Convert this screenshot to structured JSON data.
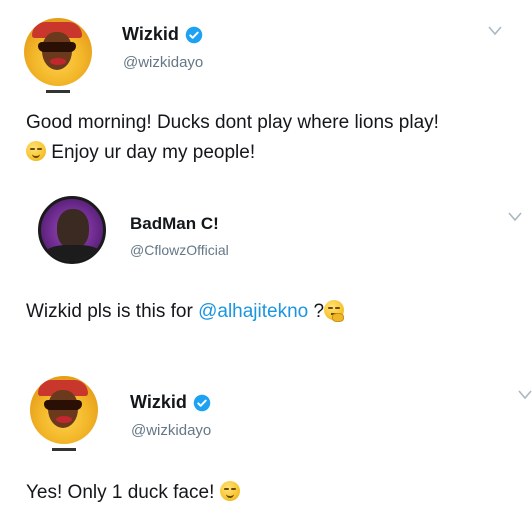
{
  "tweets": [
    {
      "name": "Wizkid",
      "handle": "@wizkidayo",
      "verified": true,
      "text": "Good morning! Ducks dont play where lions play!",
      "text_line2": "Enjoy ur day my people!",
      "emoji": "relieved-face-icon"
    },
    {
      "name": "BadMan C!",
      "handle": "@CflowzOfficial",
      "verified": false,
      "text_prefix": "Wizkid pls is this for ",
      "mention": "@alhajitekno",
      "text_suffix": " ?",
      "emoji": "thinking-face-icon"
    },
    {
      "name": "Wizkid",
      "handle": "@wizkidayo",
      "verified": true,
      "text": "Yes! Only 1 duck face!",
      "emoji": "relieved-face-icon"
    }
  ],
  "colors": {
    "verified_blue": "#1da1f2",
    "mention_blue": "#1b95e0",
    "handle_gray": "#657786",
    "text_dark": "#14171a"
  }
}
